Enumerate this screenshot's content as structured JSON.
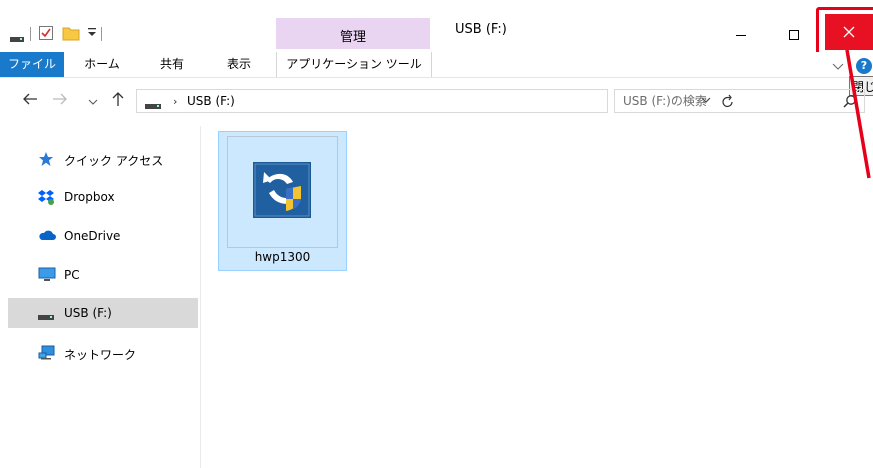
{
  "window": {
    "title": "USB (F:)",
    "tool_header": "管理",
    "close_tooltip": "閉じる"
  },
  "ribbon": {
    "tabs": [
      {
        "label": "ファイル",
        "active": true
      },
      {
        "label": "ホーム"
      },
      {
        "label": "共有"
      },
      {
        "label": "表示"
      },
      {
        "label": "アプリケーション ツール"
      }
    ]
  },
  "address": {
    "path": "USB (F:)",
    "search_placeholder": "USB (F:)の検索"
  },
  "nav": {
    "items": [
      {
        "label": "クイック アクセス",
        "icon": "star-icon"
      },
      {
        "label": "Dropbox",
        "icon": "dropbox-icon"
      },
      {
        "label": "OneDrive",
        "icon": "cloud-icon"
      },
      {
        "label": "PC",
        "icon": "pc-icon"
      },
      {
        "label": "USB (F:)",
        "icon": "drive-icon",
        "selected": true
      },
      {
        "label": "ネットワーク",
        "icon": "network-icon"
      }
    ]
  },
  "files": [
    {
      "name": "hwp1300",
      "selected": true
    }
  ],
  "colors": {
    "accent": "#1979ca",
    "close_red": "#e81123",
    "tool_tab": "#e9d5f2",
    "selection": "#cce8ff",
    "annotation": "#e6001a"
  }
}
